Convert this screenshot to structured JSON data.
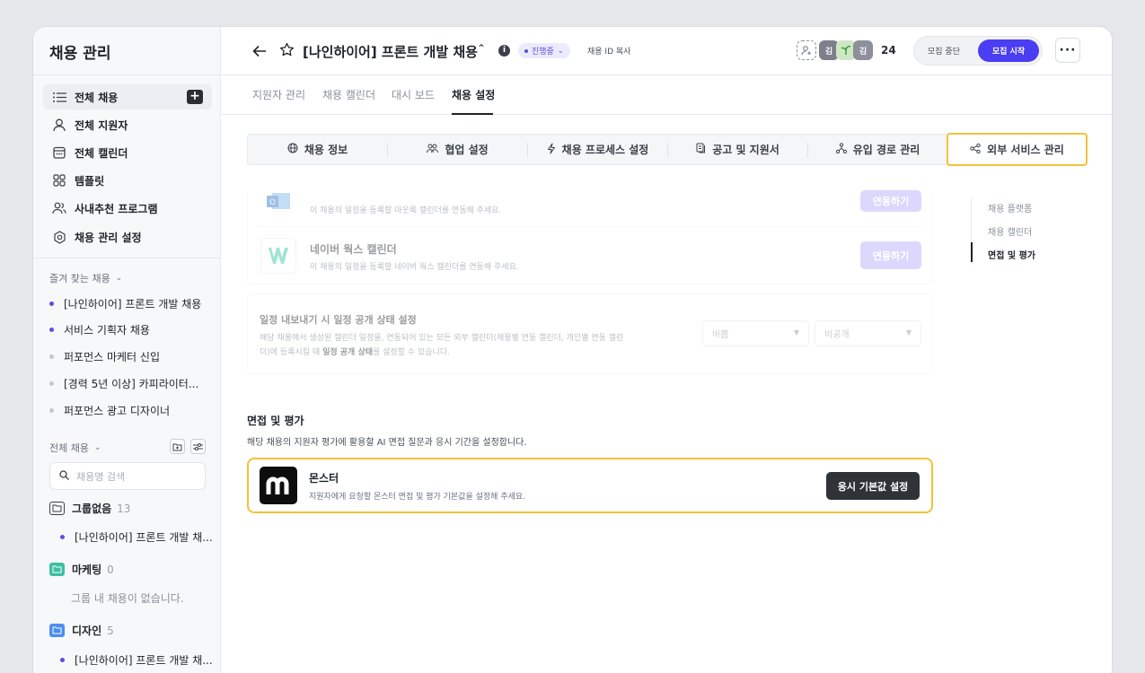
{
  "sidebar": {
    "title": "채용 관리",
    "nav": [
      {
        "label": "전체 채용",
        "icon": "list-icon"
      },
      {
        "label": "전체 지원자",
        "icon": "person-icon"
      },
      {
        "label": "전체 캘린더",
        "icon": "calendar-icon"
      },
      {
        "label": "템플릿",
        "icon": "grid-icon"
      },
      {
        "label": "사내추천 프로그램",
        "icon": "people-icon"
      },
      {
        "label": "채용 관리 설정",
        "icon": "settings-icon"
      }
    ],
    "favorites_title": "즐겨 찾는 채용",
    "favorites": [
      {
        "label": "[나인하이어] 프론트 개발 채용",
        "color": "#5b4ee0"
      },
      {
        "label": "서비스 기획자 채용",
        "color": "#5b4ee0"
      },
      {
        "label": "퍼포먼스 마케터 신입",
        "color": "#c3c7cd"
      },
      {
        "label": "[경력 5년 이상] 카피라이터...",
        "color": "#c3c7cd"
      },
      {
        "label": "퍼포먼스 광고 디자이너",
        "color": "#c3c7cd"
      }
    ],
    "all_title": "전체 채용",
    "search_placeholder": "채용명 검색",
    "groups": [
      {
        "name": "그룹없음",
        "count": "13",
        "color": "#ffffff",
        "item": "[나인하이어] 프론트 개발 채..."
      },
      {
        "name": "마케팅",
        "count": "0",
        "color": "#3dbfa3",
        "empty": "그룹 내 채용이 없습니다."
      },
      {
        "name": "디자인",
        "count": "5",
        "color": "#4a8df0",
        "item": "[나인하이어] 프론트 개발 채..."
      }
    ]
  },
  "header": {
    "title": "[나인하이어] 프론트 개발 채용",
    "status": "진행중",
    "copy_id": "채용 ID 복사",
    "avatars": [
      "김",
      "",
      "김"
    ],
    "count": "24",
    "stop_label": "모집 중단",
    "start_label": "모집 시작"
  },
  "subtabs": [
    "지원자 관리",
    "채용 캘린더",
    "대시 보드",
    "채용 설정"
  ],
  "tabs": [
    {
      "label": "채용 정보",
      "icon": "globe-icon"
    },
    {
      "label": "협업 설정",
      "icon": "people-icon"
    },
    {
      "label": "채용 프로세스 설정",
      "icon": "bolt-icon"
    },
    {
      "label": "공고 및 지원서",
      "icon": "document-icon"
    },
    {
      "label": "유입 경로 관리",
      "icon": "path-icon"
    },
    {
      "label": "외부 서비스 관리",
      "icon": "share-icon"
    }
  ],
  "calendars": {
    "outlook": {
      "desc": "이 채용의 일정을 등록할 아웃룩 캘린더를 연동해 주세요.",
      "button": "연동하기"
    },
    "naver": {
      "name": "네이버 웍스 캘린더",
      "desc": "이 채용의 일정을 등록할 네이버 웍스 캘린더를 연동해 주세요.",
      "button": "연동하기"
    }
  },
  "export": {
    "title": "일정 내보내기 시 일정 공개 상태 설정",
    "desc1": "해당 채용에서 생성된 캘린더 일정을, 연동되어 있는 모든 외부 캘린더(채용별 연동 캘린더, 개인별 연동 캘린",
    "desc2a": "더)에 등록시킬 때 ",
    "desc2b": "일정 공개 상태",
    "desc2c": "를 설정할 수 있습니다.",
    "select1": "바쁨",
    "select2": "비공개"
  },
  "toc": [
    "채용 플랫폼",
    "채용 캘린더",
    "면접 및 평가"
  ],
  "interview": {
    "title": "면접 및 평가",
    "desc": "해당 채용의 지원자 평가에 활용할 AI 면접 질문과 응시 기간을 설정합니다.",
    "service_name": "몬스터",
    "service_desc": "지원자에게 요청할 몬스터 면접 및 평가 기본값을 설정해 주세요.",
    "button": "응시 기본값 설정"
  }
}
